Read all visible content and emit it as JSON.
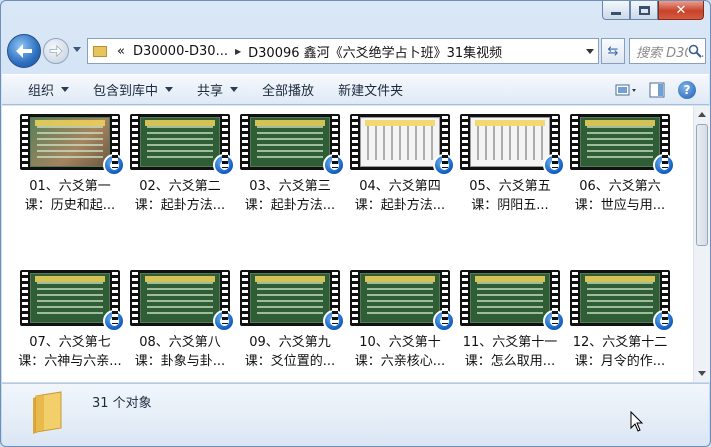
{
  "caption_buttons": {
    "minimize": "minimize",
    "maximize": "maximize",
    "close": "close"
  },
  "address": {
    "crumbs": [
      "«",
      "D30000-D30...",
      "D30096 鑫河《六爻绝学占卜班》31集视频"
    ],
    "search_placeholder": "搜索 D30..."
  },
  "toolbar": {
    "organize": "组织",
    "include_library": "包含到库中",
    "share": "共享",
    "play_all": "全部播放",
    "new_folder": "新建文件夹"
  },
  "files": [
    {
      "line1": "01、六爻第一",
      "line2": "课：历史和起...",
      "style": "photo"
    },
    {
      "line1": "02、六爻第二",
      "line2": "课：起卦方法...",
      "style": "green"
    },
    {
      "line1": "03、六爻第三",
      "line2": "课：起卦方法...",
      "style": "green"
    },
    {
      "line1": "04、六爻第四",
      "line2": "课：起卦方法...",
      "style": "bright"
    },
    {
      "line1": "05、六爻第五",
      "line2": "课：阴阳五...",
      "style": "bright"
    },
    {
      "line1": "06、六爻第六",
      "line2": "课：世应与用...",
      "style": "green"
    },
    {
      "line1": "07、六爻第七",
      "line2": "课：六神与六亲...",
      "style": "green"
    },
    {
      "line1": "08、六爻第八",
      "line2": "课：卦象与卦...",
      "style": "green"
    },
    {
      "line1": "09、六爻第九",
      "line2": "课：爻位置的...",
      "style": "green"
    },
    {
      "line1": "10、六爻第十",
      "line2": "课：六亲核心...",
      "style": "green"
    },
    {
      "line1": "11、六爻第十一",
      "line2": "课：怎么取用...",
      "style": "green"
    },
    {
      "line1": "12、六爻第十二",
      "line2": "课：月令的作...",
      "style": "green"
    }
  ],
  "status": {
    "count": "31 个对象"
  }
}
